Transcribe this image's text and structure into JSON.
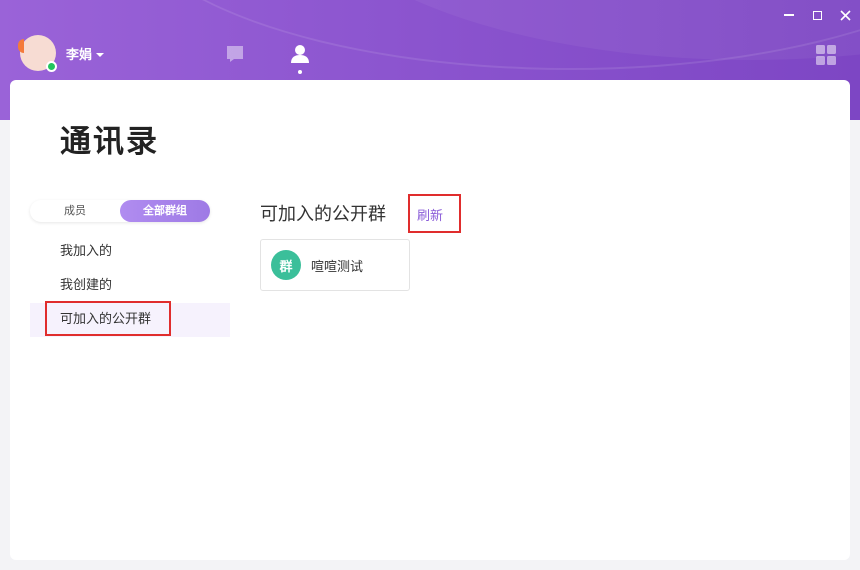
{
  "window": {
    "controls": [
      "minimize",
      "maximize",
      "close"
    ]
  },
  "header": {
    "user_name": "李娟",
    "status": "online",
    "nav": [
      {
        "icon": "chat-icon"
      },
      {
        "icon": "contacts-icon",
        "active": true
      }
    ],
    "apps_icon": "apps-grid-icon"
  },
  "page": {
    "title": "通讯录"
  },
  "segment": {
    "options": [
      "成员",
      "全部群组"
    ],
    "active_index": 1
  },
  "sidebar": {
    "items": [
      {
        "label": "我加入的"
      },
      {
        "label": "我创建的"
      },
      {
        "label": "可加入的公开群",
        "selected": true
      }
    ]
  },
  "main": {
    "section_title": "可加入的公开群",
    "refresh_label": "刷新",
    "groups": [
      {
        "avatar_text": "群",
        "name": "喧喧测试"
      }
    ]
  },
  "colors": {
    "accent": "#8a5cd8",
    "header_gradient_start": "#9a63d8",
    "header_gradient_end": "#7d46c4",
    "group_avatar": "#3bbf9a",
    "highlight": "#e02d2d"
  }
}
